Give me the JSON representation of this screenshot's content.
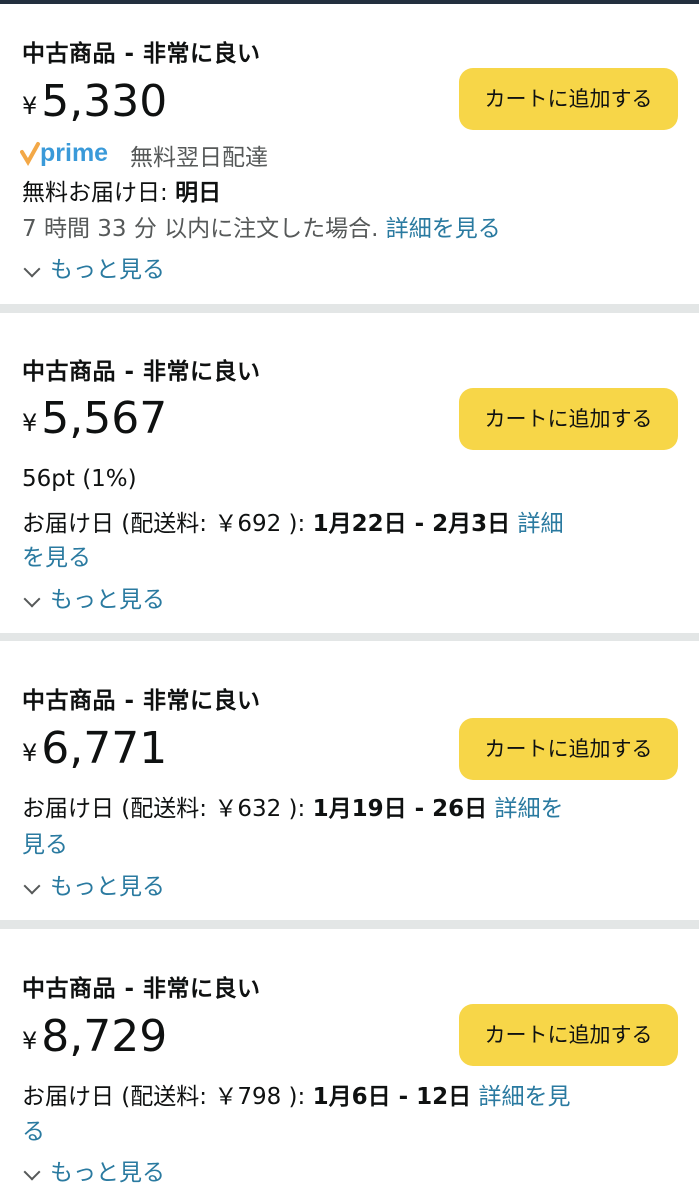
{
  "cart_label": "カートに追加する",
  "more_label": "もっと見る",
  "offers": [
    {
      "condition": "中古商品 - 非常に良い",
      "yen": "¥",
      "price": "5,330",
      "prime_label": "prime",
      "prime_text": "無料翌日配達",
      "delivery_prefix": "無料お届け日: ",
      "delivery_date": "明日",
      "cutoff_text": "7 時間 33 分 以内に注文した場合. ",
      "details_link": "詳細を見る"
    },
    {
      "condition": "中古商品 - 非常に良い",
      "yen": "¥",
      "price": "5,567",
      "points": "56pt (1%)",
      "delivery_prefix": "お届け日 (配送料: ￥692 ): ",
      "delivery_date": "1月22日 - 2月3日",
      "details_link_a": "詳細",
      "details_link_b": "を見る"
    },
    {
      "condition": "中古商品 - 非常に良い",
      "yen": "¥",
      "price": "6,771",
      "delivery_prefix": "お届け日 (配送料: ￥632 ): ",
      "delivery_date": "1月19日 - 26日",
      "details_link_a": "詳細を",
      "details_link_b": "見る"
    },
    {
      "condition": "中古商品 - 非常に良い",
      "yen": "¥",
      "price": "8,729",
      "delivery_prefix": "お届け日 (配送料: ￥798 ): ",
      "delivery_date": "1月6日 - 12日",
      "details_link_a": "詳細を見",
      "details_link_b": "る"
    }
  ],
  "colors": {
    "button": "#f7d648",
    "link": "#2a7aa0",
    "prime_check": "#f3a847",
    "prime_blue": "#3a9ad9"
  }
}
